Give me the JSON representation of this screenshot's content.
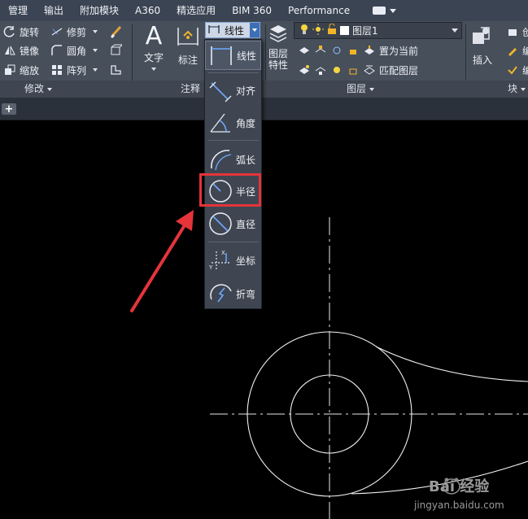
{
  "menubar": {
    "tabs": [
      "管理",
      "输出",
      "附加模块",
      "A360",
      "精选应用",
      "BIM 360",
      "Performance"
    ]
  },
  "modify_panel": {
    "title": "修改",
    "tools": [
      {
        "label": "旋转",
        "icon": "rotate-icon"
      },
      {
        "label": "修剪",
        "icon": "trim-icon"
      },
      {
        "label": "镜像",
        "icon": "mirror-icon"
      },
      {
        "label": "圆角",
        "icon": "fillet-icon"
      },
      {
        "label": "缩放",
        "icon": "scale-icon"
      },
      {
        "label": "阵列",
        "icon": "array-icon"
      }
    ]
  },
  "annotation_panel": {
    "title": "注释",
    "text_label": "文字",
    "dimension_label": "标注",
    "linetype_selected": "线性"
  },
  "layer_panel": {
    "title": "图层",
    "properties_label": "图层\n特性",
    "current_layer": "图层1",
    "set_current_label": "置为当前",
    "match_layer_label": "匹配图层"
  },
  "block_panel": {
    "title": "块",
    "insert_label": "插入",
    "create_label": "创",
    "edit_label": "编",
    "edit2_label": "编"
  },
  "dimension_menu": {
    "items": [
      {
        "label": "线性",
        "icon": "linear-dimension-icon"
      },
      {
        "label": "对齐",
        "icon": "aligned-dimension-icon"
      },
      {
        "label": "角度",
        "icon": "angular-dimension-icon"
      },
      {
        "label": "弧长",
        "icon": "arc-length-icon"
      },
      {
        "label": "半径",
        "icon": "radius-icon"
      },
      {
        "label": "直径",
        "icon": "diameter-icon"
      },
      {
        "label": "坐标",
        "icon": "ordinate-icon"
      },
      {
        "label": "折弯",
        "icon": "jogged-icon"
      }
    ],
    "highlighted": "半径"
  },
  "filetabs": {
    "add_label": "+"
  },
  "watermark": {
    "text_cn": "Bai 经验",
    "text_url": "jingyan.baidu.com"
  },
  "colors": {
    "accent": "#3d6fb6",
    "highlight": "#e5343a",
    "canvas": "#000000"
  }
}
